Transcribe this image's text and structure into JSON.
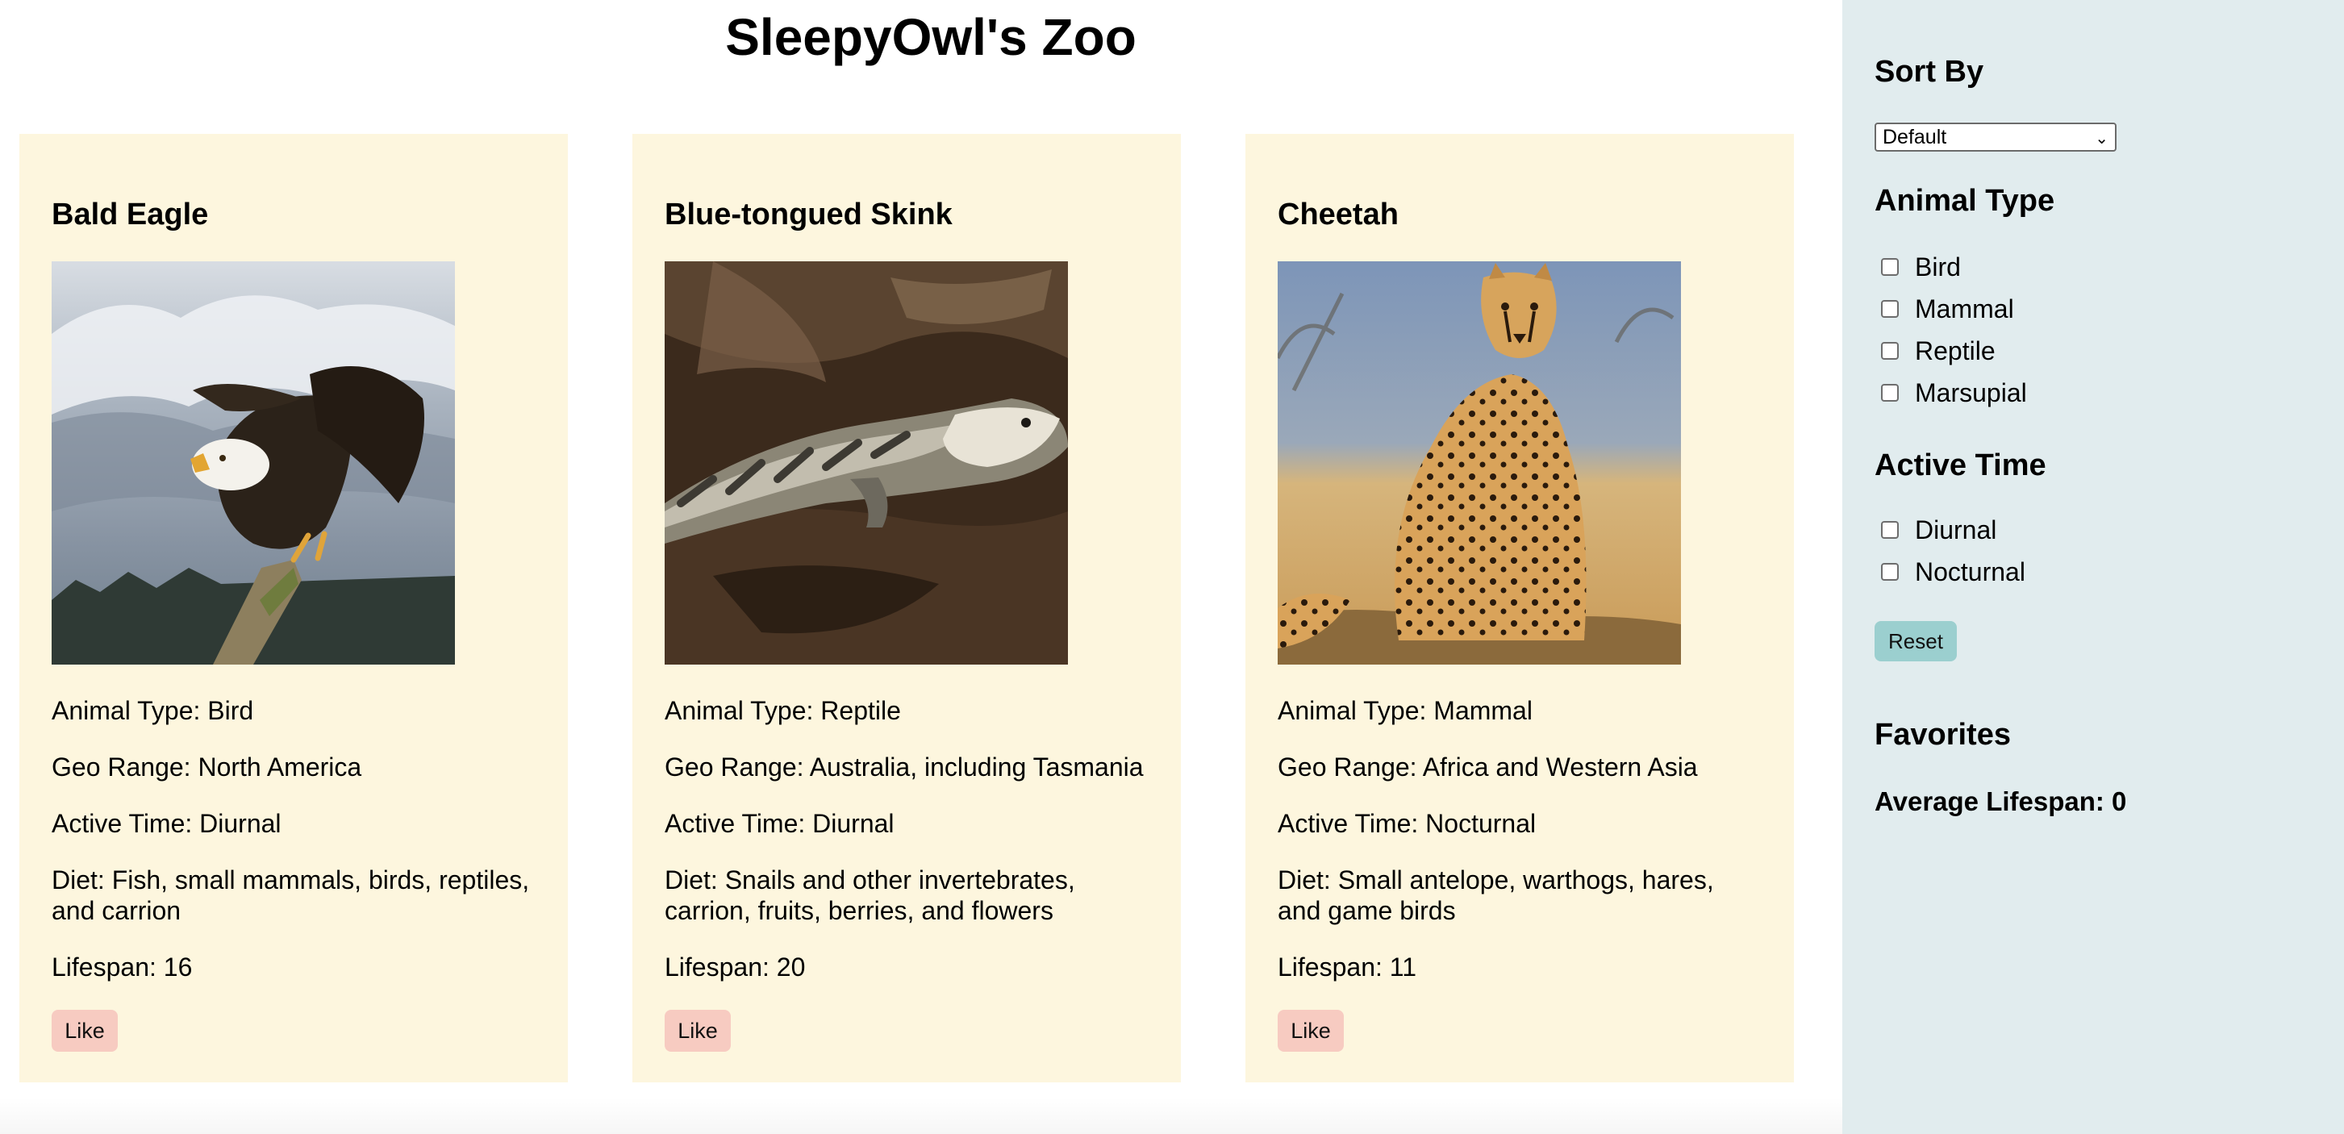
{
  "page": {
    "title": "SleepyOwl's Zoo"
  },
  "animals": [
    {
      "name": "Bald Eagle",
      "type_text": "Animal Type: Bird",
      "geo_text": "Geo Range: North America",
      "time_text": "Active Time: Diurnal",
      "diet_text": "Diet: Fish, small mammals, birds, reptiles, and carrion",
      "lifespan_text": "Lifespan: 16",
      "like_label": "Like"
    },
    {
      "name": "Blue-tongued Skink",
      "type_text": "Animal Type: Reptile",
      "geo_text": "Geo Range: Australia, including Tasmania",
      "time_text": "Active Time: Diurnal",
      "diet_text": "Diet: Snails and other invertebrates, carrion, fruits, berries, and flowers",
      "lifespan_text": "Lifespan: 20",
      "like_label": "Like"
    },
    {
      "name": "Cheetah",
      "type_text": "Animal Type: Mammal",
      "geo_text": "Geo Range: Africa and Western Asia",
      "time_text": "Active Time: Nocturnal",
      "diet_text": "Diet: Small antelope, warthogs, hares, and game birds",
      "lifespan_text": "Lifespan: 11",
      "like_label": "Like"
    }
  ],
  "sidebar": {
    "sort_heading": "Sort By",
    "sort_selected": "Default",
    "type_heading": "Animal Type",
    "type_options": [
      "Bird",
      "Mammal",
      "Reptile",
      "Marsupial"
    ],
    "time_heading": "Active Time",
    "time_options": [
      "Diurnal",
      "Nocturnal"
    ],
    "reset_label": "Reset",
    "favorites_heading": "Favorites",
    "average_lifespan_text": "Average Lifespan: 0"
  },
  "colors": {
    "card_background": "#fdf6de",
    "sidebar_background": "#e1ecee",
    "like_button": "#f7cbc1",
    "reset_button": "#9bcfcf"
  }
}
